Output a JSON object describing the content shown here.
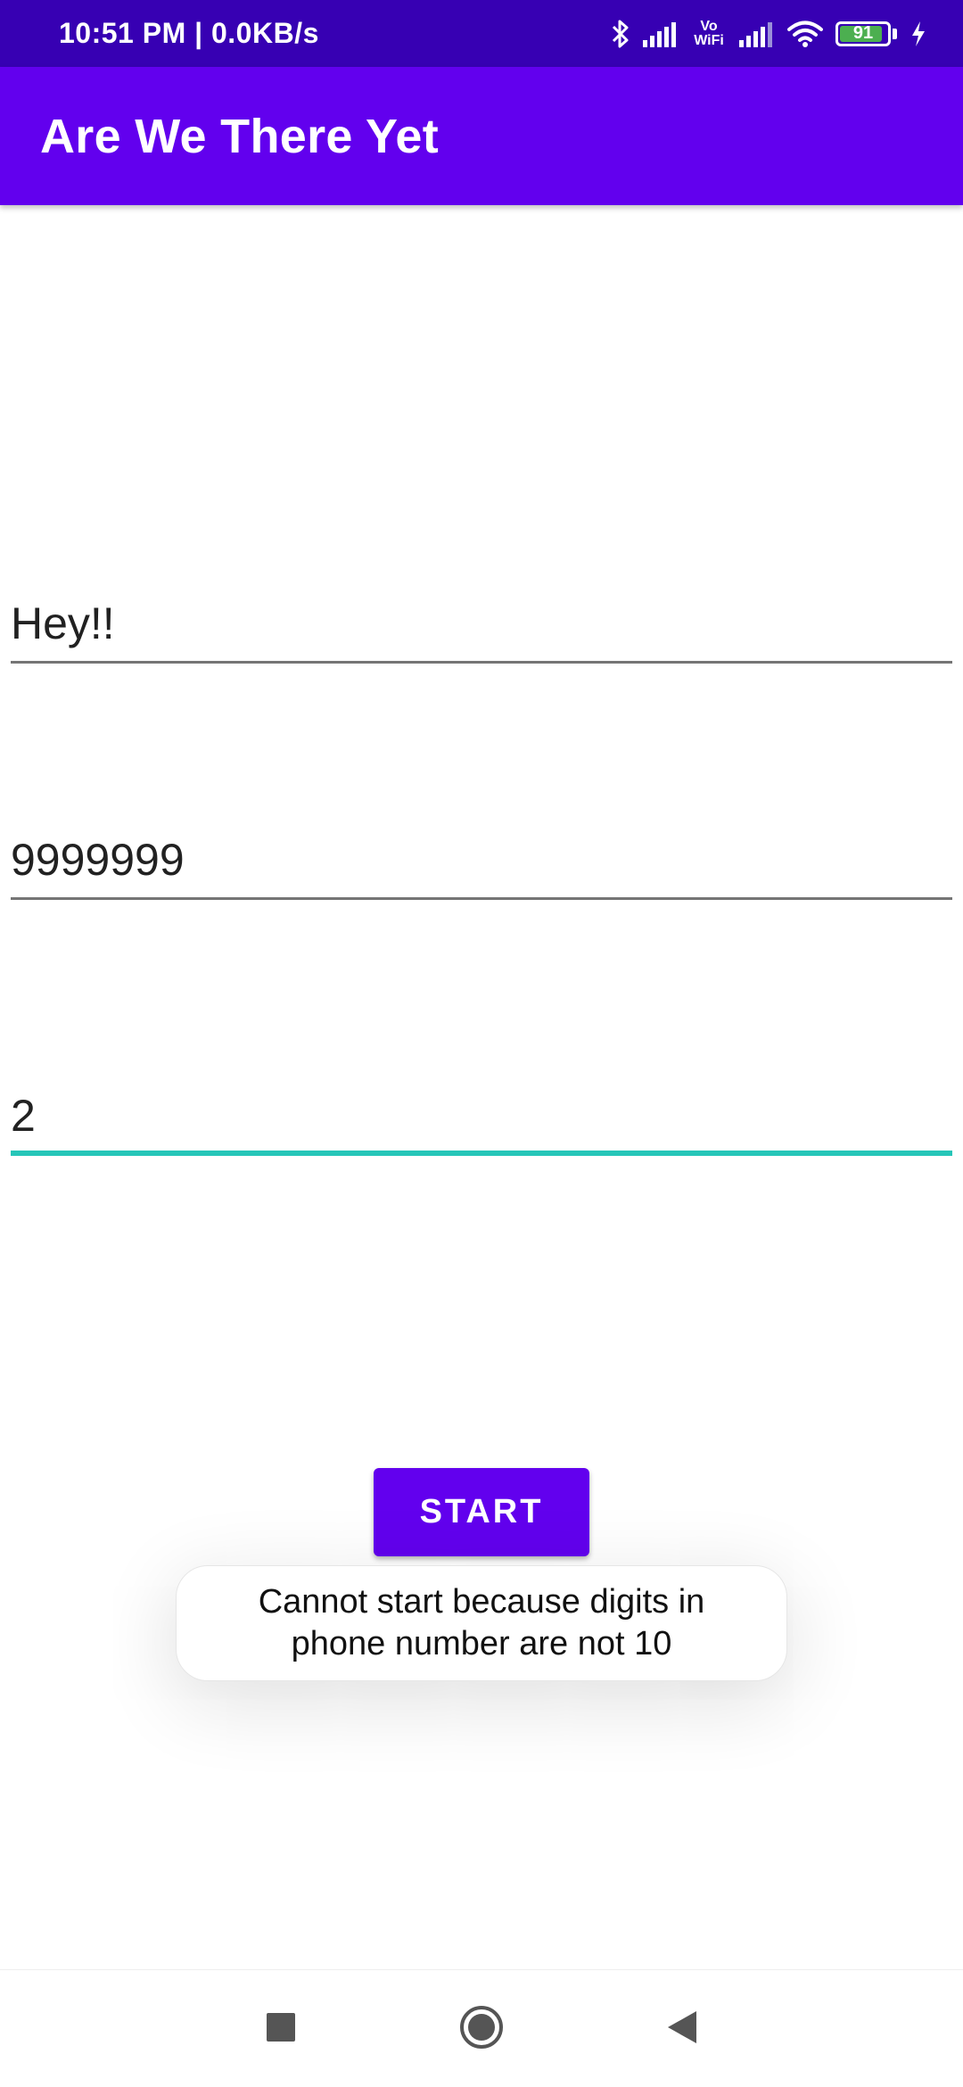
{
  "status_bar": {
    "time_speed": "10:51 PM | 0.0KB/s",
    "vowifi_top": "Vo",
    "vowifi_bottom": "WiFi",
    "battery_level": "91",
    "icons": [
      "bluetooth-icon",
      "signal-icon",
      "vowifi-icon",
      "signal-icon",
      "wifi-icon",
      "battery-icon",
      "charging-icon"
    ]
  },
  "app_bar": {
    "title": "Are We There Yet"
  },
  "form": {
    "message_value": "Hey!!",
    "phone_value": "9999999",
    "minutes_value": "2"
  },
  "actions": {
    "start_label": "START"
  },
  "toast": {
    "message": "Cannot start because digits in phone number are not 10"
  },
  "nav_bar": {
    "icons": [
      "recents-icon",
      "home-icon",
      "back-icon"
    ]
  },
  "colors": {
    "status_bar": "#3700b3",
    "primary": "#6200ee",
    "focus_underline": "#26c6b8"
  }
}
